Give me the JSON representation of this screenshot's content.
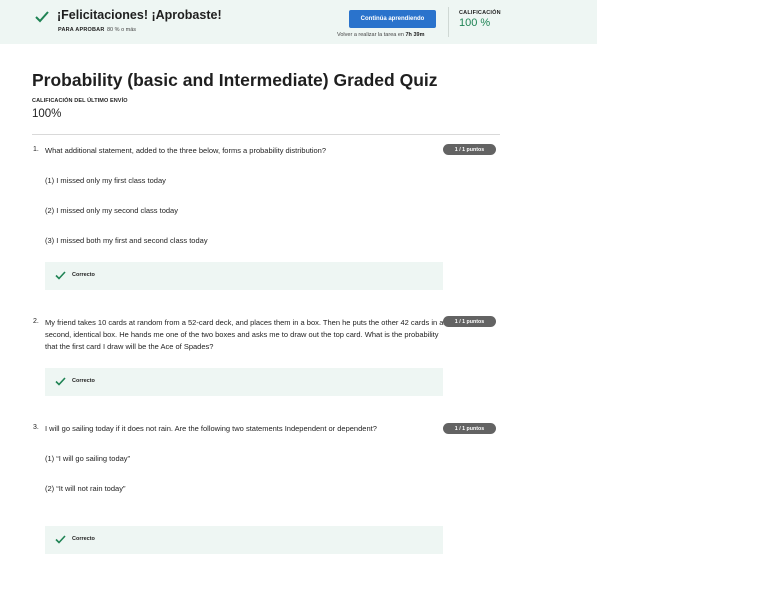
{
  "banner": {
    "title": "¡Felicitaciones! ¡Aprobaste!",
    "pass_label": "PARA APROBAR",
    "pass_value": "80 % o más",
    "continue_label": "Continúa aprendiendo",
    "retry_prefix": "Volver a realizar la tarea en",
    "retry_time": "7h 39m",
    "grade_label": "CALIFICACIÓN",
    "grade_value": "100 %"
  },
  "quiz": {
    "title": "Probability (basic and Intermediate) Graded Quiz",
    "last_label": "CALIFICACIÓN DEL ÚLTIMO ENVÍO",
    "last_value": "100%"
  },
  "questions": [
    {
      "number": "1.",
      "text": "What additional statement, added to the three below, forms a probability distribution?",
      "points": "1 / 1 puntos",
      "options": [
        "(1) I missed only my first class today",
        "(2) I missed only my second class today",
        "(3) I missed both my first and second class today"
      ],
      "feedback": "Correcto"
    },
    {
      "number": "2.",
      "text": "My friend takes 10 cards at random from a 52-card deck, and places them in a box. Then he puts the other 42 cards in a second, identical box. He hands me one of the two boxes and asks me to draw out the top card. What is the probability that the first card I draw will be the Ace of Spades?",
      "points": "1 / 1 puntos",
      "options": [],
      "feedback": "Correcto"
    },
    {
      "number": "3.",
      "text": "I will go sailing today if it does not rain. Are the following two statements Independent or dependent?",
      "points": "1 / 1 puntos",
      "options": [
        "(1) “I will go sailing today”",
        "(2) “It will not rain today”"
      ],
      "feedback": "Correcto"
    }
  ],
  "colors": {
    "banner_bg": "#eef6f3",
    "accent_green": "#1f8354",
    "button_blue": "#2a73cc",
    "points_badge": "#636363"
  }
}
